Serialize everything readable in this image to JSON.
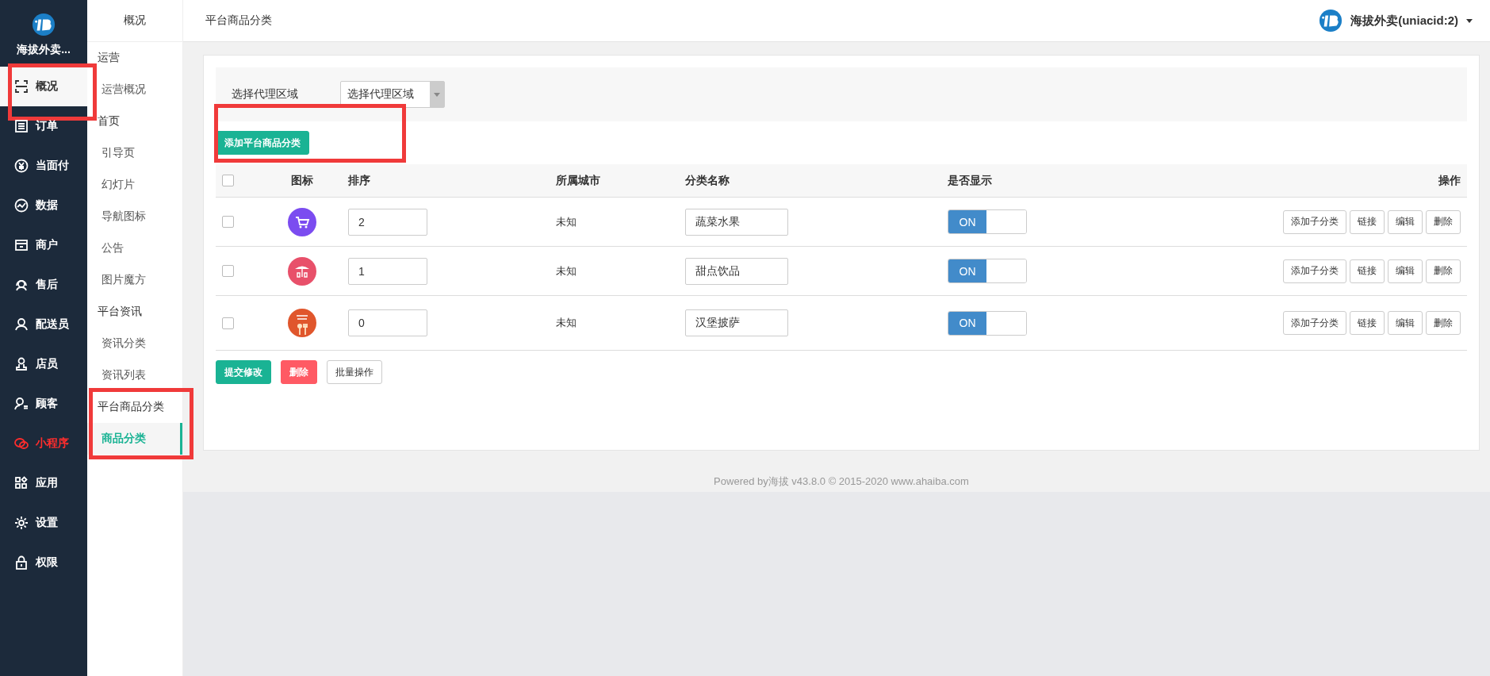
{
  "sidebar": {
    "brand": "海拔外卖...",
    "items": [
      {
        "label": "概况",
        "selected": true,
        "highlighted": true,
        "color": "#333333"
      },
      {
        "label": "订单",
        "selected": false,
        "highlighted": false,
        "color": "#ffffff"
      },
      {
        "label": "当面付",
        "selected": false,
        "highlighted": false,
        "color": "#ffffff"
      },
      {
        "label": "数据",
        "selected": false,
        "highlighted": false,
        "color": "#ffffff"
      },
      {
        "label": "商户",
        "selected": false,
        "highlighted": false,
        "color": "#ffffff"
      },
      {
        "label": "售后",
        "selected": false,
        "highlighted": false,
        "color": "#ffffff"
      },
      {
        "label": "配送员",
        "selected": false,
        "highlighted": false,
        "color": "#ffffff"
      },
      {
        "label": "店员",
        "selected": false,
        "highlighted": false,
        "color": "#ffffff"
      },
      {
        "label": "顾客",
        "selected": false,
        "highlighted": false,
        "color": "#ffffff"
      },
      {
        "label": "小程序",
        "selected": false,
        "highlighted": false,
        "color": "#ff2d2d"
      },
      {
        "label": "应用",
        "selected": false,
        "highlighted": false,
        "color": "#ffffff"
      },
      {
        "label": "设置",
        "selected": false,
        "highlighted": false,
        "color": "#ffffff"
      },
      {
        "label": "权限",
        "selected": false,
        "highlighted": false,
        "color": "#ffffff"
      }
    ]
  },
  "subnav": {
    "header": "概况",
    "groups": [
      {
        "title": "运营",
        "highlighted": false,
        "items": [
          {
            "label": "运营概况",
            "selected": false
          }
        ]
      },
      {
        "title": "首页",
        "highlighted": false,
        "items": [
          {
            "label": "引导页",
            "selected": false
          },
          {
            "label": "幻灯片",
            "selected": false
          },
          {
            "label": "导航图标",
            "selected": false
          },
          {
            "label": "公告",
            "selected": false
          },
          {
            "label": "图片魔方",
            "selected": false
          }
        ]
      },
      {
        "title": "平台资讯",
        "highlighted": false,
        "items": [
          {
            "label": "资讯分类",
            "selected": false
          },
          {
            "label": "资讯列表",
            "selected": false
          }
        ]
      },
      {
        "title": "平台商品分类",
        "highlighted": true,
        "items": [
          {
            "label": "商品分类",
            "selected": true
          }
        ]
      }
    ]
  },
  "topbar": {
    "title": "平台商品分类",
    "user": "海拔外卖(uniacid:2)"
  },
  "filter": {
    "label": "选择代理区域",
    "select_value": "选择代理区域"
  },
  "add_button": {
    "label": "添加平台商品分类",
    "highlighted": true
  },
  "table": {
    "select_all_checked": false,
    "columns": [
      "图标",
      "排序",
      "所属城市",
      "分类名称",
      "是否显示",
      "操作"
    ],
    "rows": [
      {
        "checked": false,
        "sort": "2",
        "city": "未知",
        "name": "蔬菜水果",
        "visible": true,
        "switch_label": "ON",
        "actions": [
          "添加子分类",
          "链接",
          "编辑",
          "删除"
        ]
      },
      {
        "checked": false,
        "sort": "1",
        "city": "未知",
        "name": "甜点饮品",
        "visible": true,
        "switch_label": "ON",
        "actions": [
          "添加子分类",
          "链接",
          "编辑",
          "删除"
        ]
      },
      {
        "checked": false,
        "sort": "0",
        "city": "未知",
        "name": "汉堡披萨",
        "visible": true,
        "switch_label": "ON",
        "actions": [
          "添加子分类",
          "链接",
          "编辑",
          "删除"
        ]
      }
    ]
  },
  "bottom_buttons": [
    {
      "label": "提交修改",
      "kind": "primary"
    },
    {
      "label": "删除",
      "kind": "danger"
    },
    {
      "label": "批量操作",
      "kind": "default"
    }
  ],
  "footer": "Powered by海拔 v43.8.0 © 2015-2020 www.ahaiba.com"
}
